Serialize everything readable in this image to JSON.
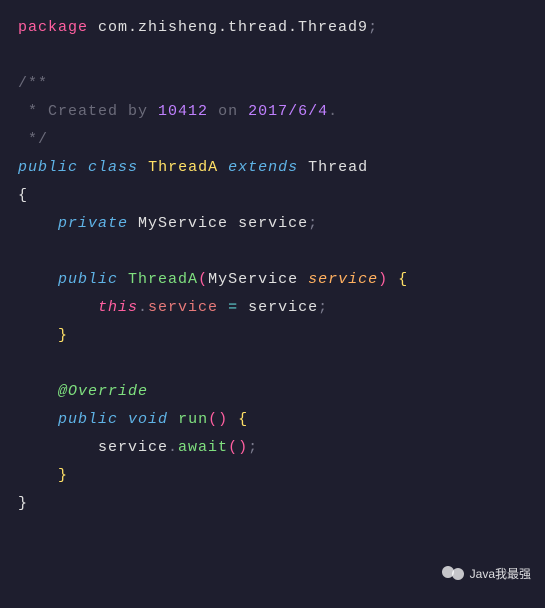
{
  "code": {
    "package_kw": "package",
    "package_name": " com.zhisheng.thread.Thread9",
    "doc_open": "/**",
    "doc_line_star": " *",
    "doc_text": " Created by ",
    "doc_num1": "10412",
    "doc_text2": " on ",
    "doc_num2": "2017/6/4",
    "doc_close": " */",
    "public": "public",
    "class": "class",
    "clsA": "ThreadA",
    "extends": "extends",
    "thread": "Thread",
    "private": "private",
    "myservice": "MyService",
    "field_service": "service",
    "ctor": "ThreadA",
    "param_service": "service",
    "this": "this",
    "override": "@Override",
    "void": "void",
    "run": "run",
    "await": "await"
  },
  "watermark": {
    "text": "Java我最强"
  }
}
